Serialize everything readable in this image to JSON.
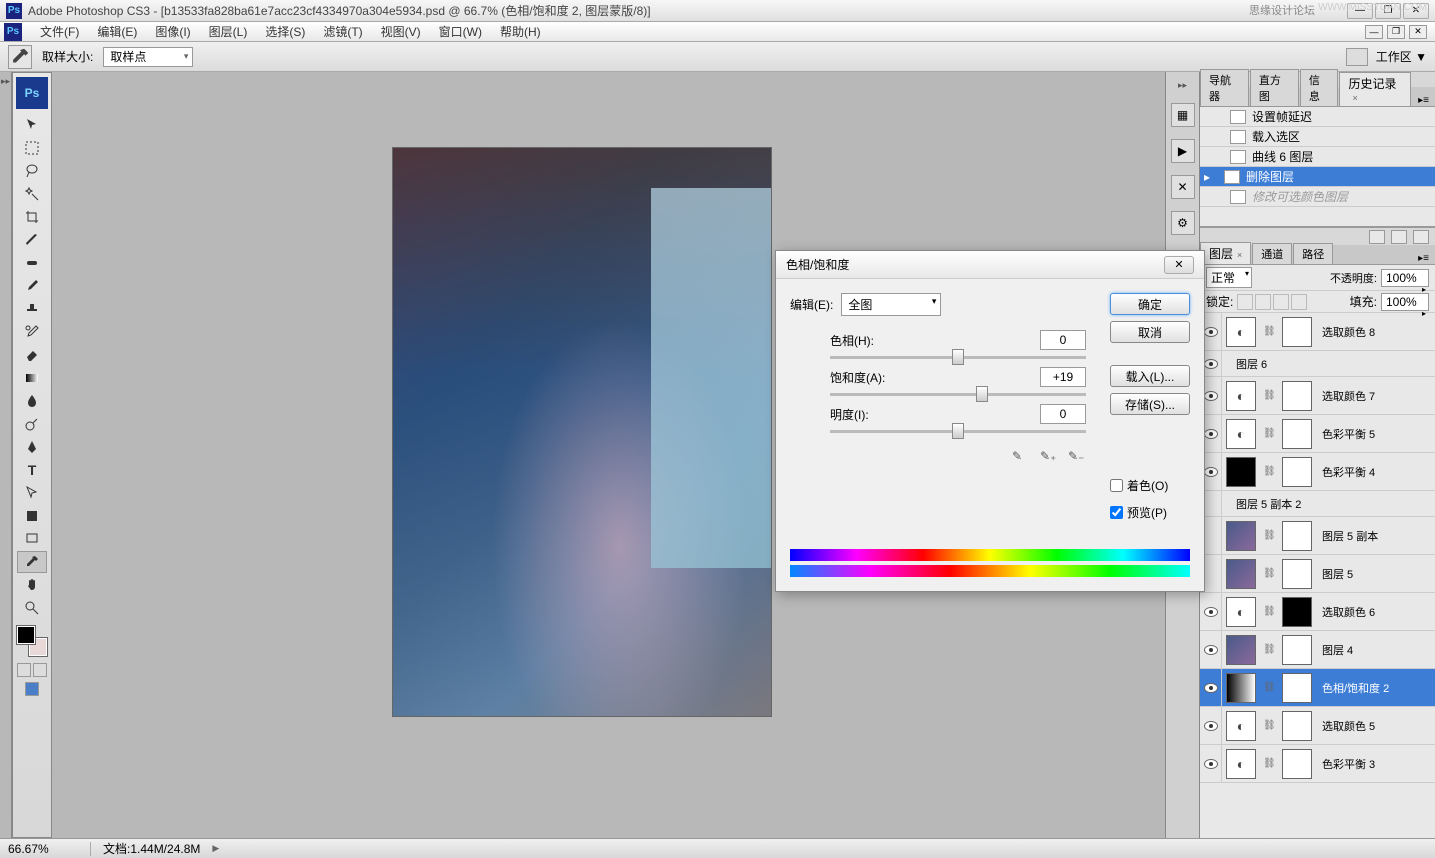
{
  "title": "Adobe Photoshop CS3 - [b13533fa828ba61e7acc23cf4334970a304e5934.psd @ 66.7% (色相/饱和度 2, 图层蒙版/8)]",
  "watermark": "思缘设计论坛",
  "watermark2": "WWW.MISSYUAN.COM",
  "menu": {
    "file": "文件(F)",
    "edit": "编辑(E)",
    "image": "图像(I)",
    "layer": "图层(L)",
    "select": "选择(S)",
    "filter": "滤镜(T)",
    "view": "视图(V)",
    "window": "窗口(W)",
    "help": "帮助(H)"
  },
  "options": {
    "sample_size_label": "取样大小:",
    "sample_size_value": "取样点",
    "workspace_label": "工作区 ▼"
  },
  "history_tabs": {
    "nav": "导航器",
    "hist": "直方图",
    "info": "信息",
    "history": "历史记录"
  },
  "history": [
    {
      "label": "设置帧延迟"
    },
    {
      "label": "载入选区"
    },
    {
      "label": "曲线 6 图层"
    },
    {
      "label": "删除图层",
      "selected": true
    },
    {
      "label": "修改可选颜色图层",
      "dimmed": true
    }
  ],
  "layers_tabs": {
    "layers": "图层",
    "channels": "通道",
    "paths": "路径"
  },
  "layer_controls": {
    "blend_mode": "正常",
    "opacity_label": "不透明度:",
    "opacity": "100%",
    "lock_label": "锁定:",
    "fill_label": "填充:",
    "fill": "100%"
  },
  "layers": [
    {
      "name": "选取颜色 8",
      "eye": true,
      "adj": true
    },
    {
      "name": "图层 6",
      "eye": true,
      "short": true
    },
    {
      "name": "选取颜色 7",
      "eye": true,
      "adj": true
    },
    {
      "name": "色彩平衡 5",
      "eye": true,
      "adj": true
    },
    {
      "name": "色彩平衡 4",
      "eye": true,
      "adj": true,
      "thumb": "black"
    },
    {
      "name": "图层 5 副本 2",
      "eye": false,
      "short": true
    },
    {
      "name": "图层 5 副本",
      "eye": false,
      "img": true
    },
    {
      "name": "图层 5",
      "eye": false,
      "img": true
    },
    {
      "name": "选取颜色 6",
      "eye": true,
      "adj": true,
      "mask": "black"
    },
    {
      "name": "图层 4",
      "eye": true,
      "img": true
    },
    {
      "name": "色相/饱和度 2",
      "eye": true,
      "selected": true,
      "grad": true
    },
    {
      "name": "选取颜色 5",
      "eye": true,
      "adj": true
    },
    {
      "name": "色彩平衡 3",
      "eye": true,
      "adj": true
    }
  ],
  "dialog": {
    "title": "色相/饱和度",
    "edit_label": "编辑(E):",
    "edit_value": "全图",
    "hue_label": "色相(H):",
    "hue_value": "0",
    "sat_label": "饱和度(A):",
    "sat_value": "+19",
    "light_label": "明度(I):",
    "light_value": "0",
    "ok": "确定",
    "cancel": "取消",
    "load": "载入(L)...",
    "save": "存储(S)...",
    "colorize": "着色(O)",
    "preview": "预览(P)"
  },
  "status": {
    "zoom": "66.67%",
    "doc": "文档:1.44M/24.8M"
  }
}
